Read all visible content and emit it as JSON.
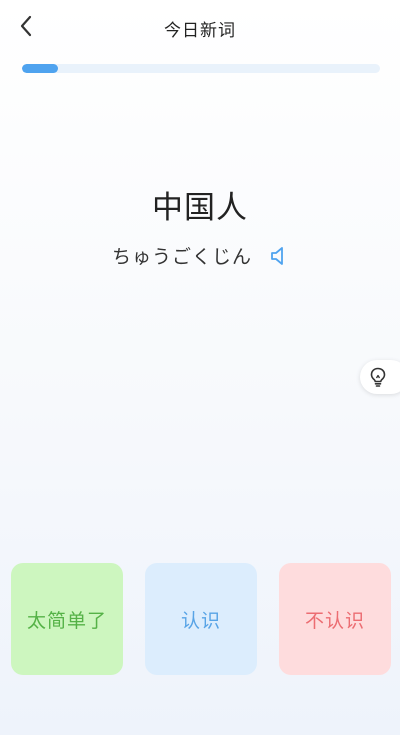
{
  "header": {
    "back_icon": "chevron-left-icon",
    "title": "今日新词"
  },
  "progress": {
    "fraction": 0.1,
    "fill_color": "#4fa3ef",
    "track_color": "#e9f2fb"
  },
  "card": {
    "word": "中国人",
    "reading": "ちゅうごくじん",
    "speaker_icon": "speaker-icon"
  },
  "hint": {
    "icon": "lightbulb-icon"
  },
  "answers": [
    {
      "label": "太简单了",
      "bg": "#cdf6bf",
      "color": "#55b247"
    },
    {
      "label": "认识",
      "bg": "#dcedfd",
      "color": "#58a4e6"
    },
    {
      "label": "不认识",
      "bg": "#fedcdd",
      "color": "#ec6d72"
    }
  ]
}
